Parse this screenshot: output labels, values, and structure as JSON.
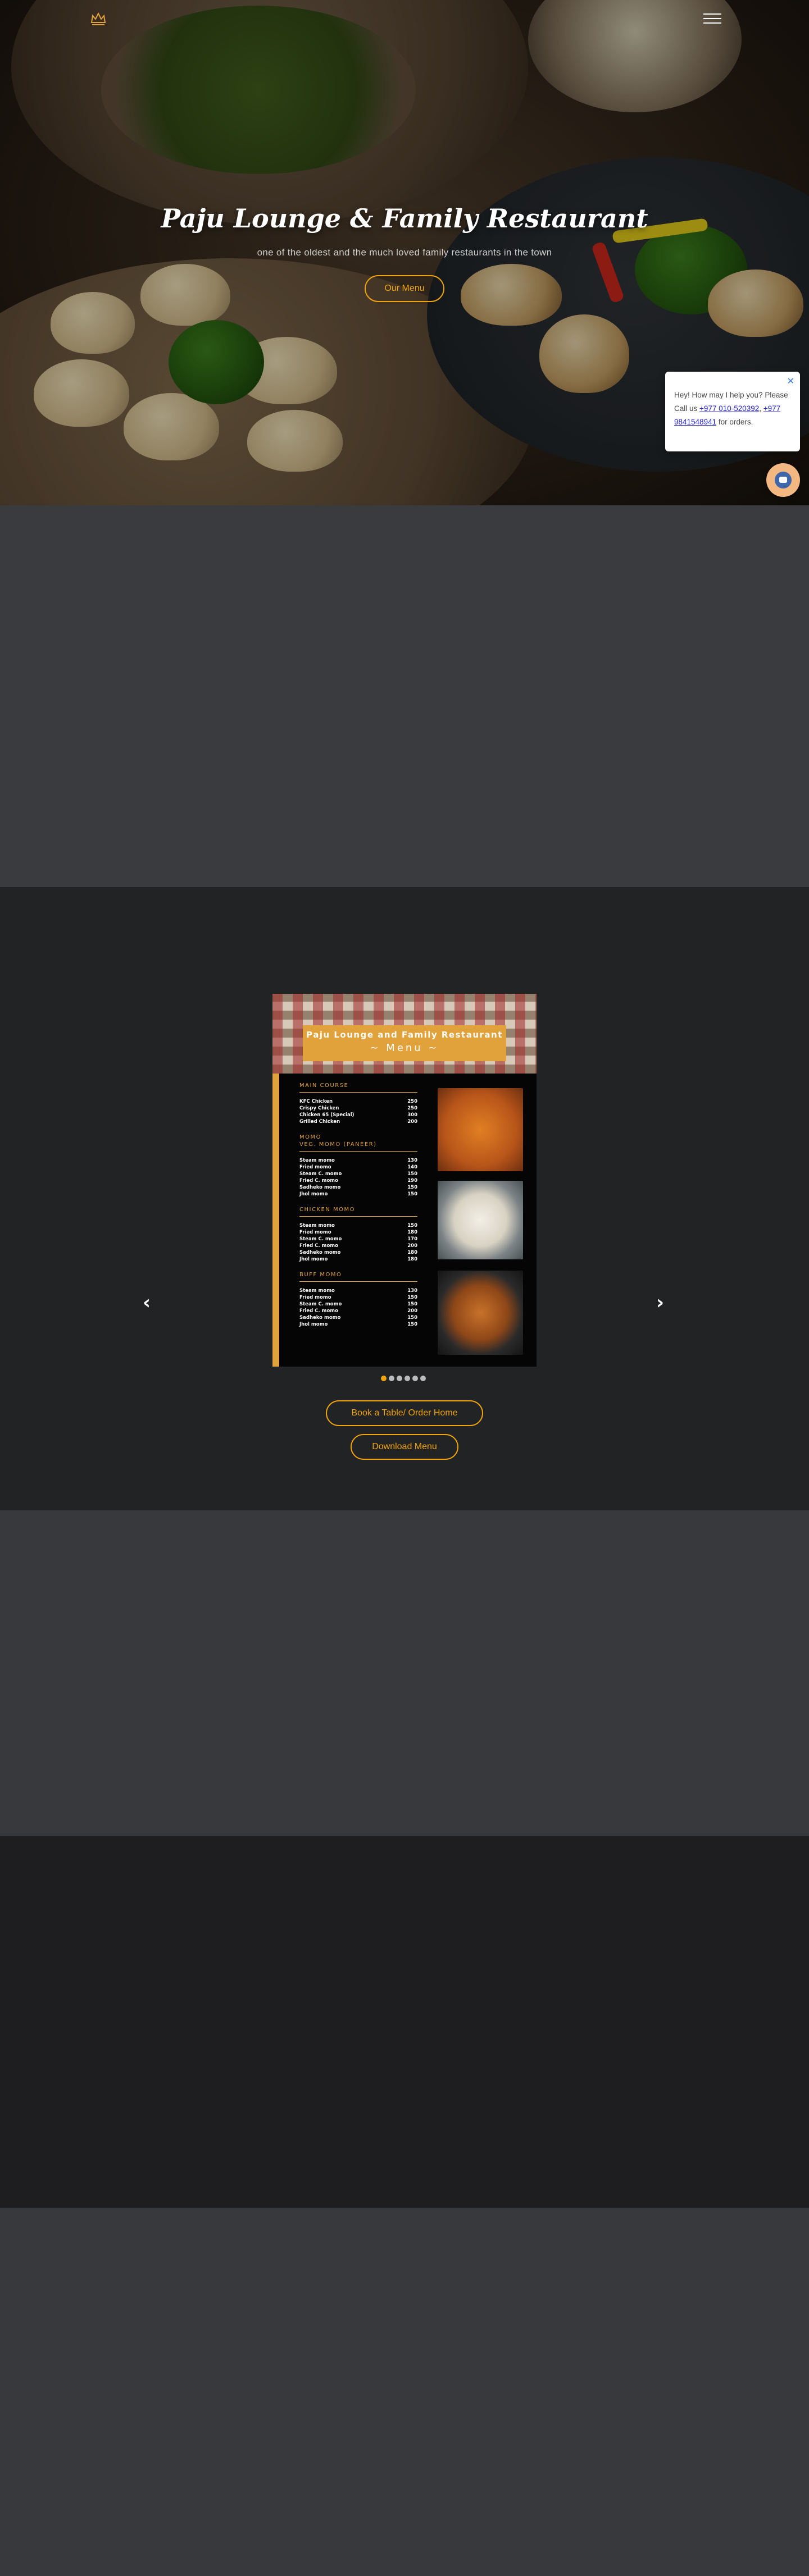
{
  "hero": {
    "title": "Paju Lounge & Family Restaurant",
    "subtitle": "one of the oldest and the much loved family restaurants in the town",
    "menu_button": "Our Menu"
  },
  "chat": {
    "message_start": "Hey! How may I help you? Please Call us ",
    "phone_1": "+977 010-520392",
    "separator": ", ",
    "phone_2": "+977 9841548941",
    "message_end": " for orders.",
    "close_icon": "close-icon",
    "launcher_icon": "chat-icon"
  },
  "menu_card": {
    "restaurant": "Paju Lounge and Family Restaurant",
    "title": "~ Menu ~",
    "sections": [
      {
        "heading": "MAIN COURSE",
        "items": [
          {
            "name": "KFC Chicken",
            "price": "250"
          },
          {
            "name": "Crispy Chicken",
            "price": "250"
          },
          {
            "name": "Chicken 65 (Special)",
            "price": "300"
          },
          {
            "name": "Grilled Chicken",
            "price": "200"
          }
        ]
      },
      {
        "heading": "MOMO",
        "subheading": "VEG. MOMO (PANEER)",
        "items": [
          {
            "name": "Steam momo",
            "price": "130"
          },
          {
            "name": "Fried momo",
            "price": "140"
          },
          {
            "name": "Steam C. momo",
            "price": "150"
          },
          {
            "name": "Fried C. momo",
            "price": "190"
          },
          {
            "name": "Sadheko momo",
            "price": "150"
          },
          {
            "name": "Jhol momo",
            "price": "150"
          }
        ]
      },
      {
        "heading": "CHICKEN MOMO",
        "items": [
          {
            "name": "Steam momo",
            "price": "150"
          },
          {
            "name": "Fried momo",
            "price": "180"
          },
          {
            "name": "Steam C. momo",
            "price": "170"
          },
          {
            "name": "Fried C. momo",
            "price": "200"
          },
          {
            "name": "Sadheko momo",
            "price": "180"
          },
          {
            "name": "Jhol momo",
            "price": "180"
          }
        ]
      },
      {
        "heading": "BUFF MOMO",
        "items": [
          {
            "name": "Steam momo",
            "price": "130"
          },
          {
            "name": "Fried momo",
            "price": "150"
          },
          {
            "name": "Steam C. momo",
            "price": "150"
          },
          {
            "name": "Fried C. momo",
            "price": "200"
          },
          {
            "name": "Sadheko momo",
            "price": "150"
          },
          {
            "name": "Jhol momo",
            "price": "150"
          }
        ]
      }
    ]
  },
  "carousel": {
    "prev": "‹",
    "next": "›",
    "slide_count": 6,
    "active_slide": 1
  },
  "actions": {
    "book_button": "Book a Table/ Order Home",
    "download_button": "Download Menu"
  },
  "colors": {
    "accent": "#f0a30a",
    "menu_gold": "#e2a23b",
    "dark_section": "#222325",
    "gray_section": "#38393c"
  }
}
